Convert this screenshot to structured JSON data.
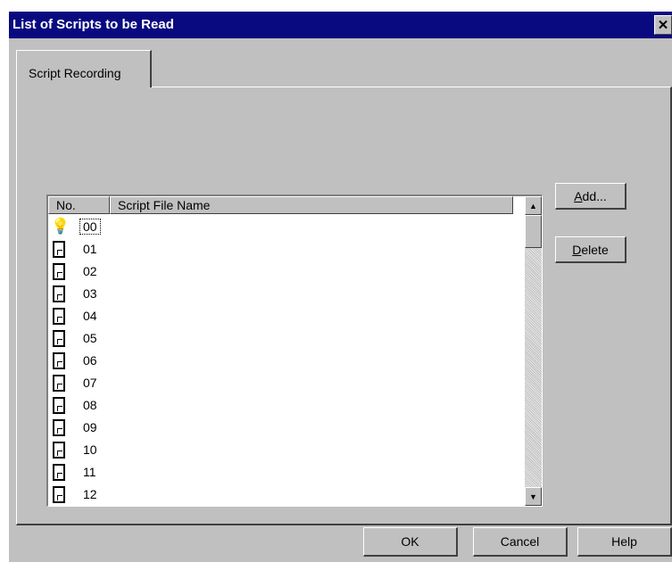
{
  "window": {
    "title": "List of Scripts to be Read",
    "close_label": "✕"
  },
  "tabs": [
    {
      "label": "Script Recording"
    }
  ],
  "list": {
    "columns": [
      "No.",
      "Script File Name"
    ],
    "rows": [
      {
        "no": "00",
        "icon": "lightbulb-icon",
        "file": ""
      },
      {
        "no": "01",
        "icon": "document-icon",
        "file": ""
      },
      {
        "no": "02",
        "icon": "document-icon",
        "file": ""
      },
      {
        "no": "03",
        "icon": "document-icon",
        "file": ""
      },
      {
        "no": "04",
        "icon": "document-icon",
        "file": ""
      },
      {
        "no": "05",
        "icon": "document-icon",
        "file": ""
      },
      {
        "no": "06",
        "icon": "document-icon",
        "file": ""
      },
      {
        "no": "07",
        "icon": "document-icon",
        "file": ""
      },
      {
        "no": "08",
        "icon": "document-icon",
        "file": ""
      },
      {
        "no": "09",
        "icon": "document-icon",
        "file": ""
      },
      {
        "no": "10",
        "icon": "document-icon",
        "file": ""
      },
      {
        "no": "11",
        "icon": "document-icon",
        "file": ""
      },
      {
        "no": "12",
        "icon": "document-icon",
        "file": ""
      }
    ],
    "selected_no": "00"
  },
  "side_buttons": {
    "add": {
      "mnemonic": "A",
      "rest": "dd..."
    },
    "delete": {
      "mnemonic": "D",
      "rest": "elete"
    }
  },
  "footer": {
    "ok": "OK",
    "cancel": "Cancel",
    "help": "Help"
  },
  "colors": {
    "titlebar": "#0a0a80",
    "face": "#c0c0c0",
    "list_bg": "#ffffff"
  }
}
